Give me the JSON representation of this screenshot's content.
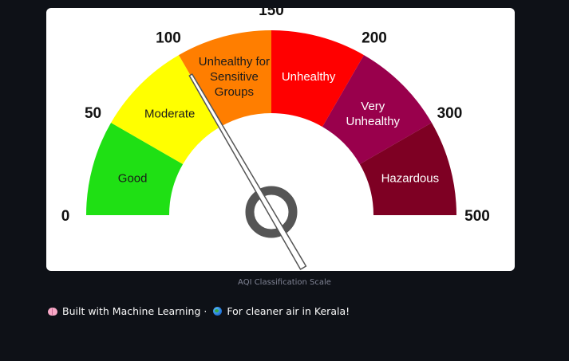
{
  "gauge": {
    "segments": [
      {
        "label": "Good",
        "label_lines": [
          "Good"
        ],
        "color": "#1fe014",
        "text_color": "#1a1a1a"
      },
      {
        "label": "Moderate",
        "label_lines": [
          "Moderate"
        ],
        "color": "#ffff00",
        "text_color": "#1a1a1a"
      },
      {
        "label": "Unhealthy for Sensitive Groups",
        "label_lines": [
          "Unhealthy for",
          "Sensitive",
          "Groups"
        ],
        "color": "#ff7e00",
        "text_color": "#1a1a1a"
      },
      {
        "label": "Unhealthy",
        "label_lines": [
          "Unhealthy"
        ],
        "color": "#ff0000",
        "text_color": "#ffffff"
      },
      {
        "label": "Very Unhealthy",
        "label_lines": [
          "Very",
          "Unhealthy"
        ],
        "color": "#99004c",
        "text_color": "#ffffff"
      },
      {
        "label": "Hazardous",
        "label_lines": [
          "Hazardous"
        ],
        "color": "#7e0023",
        "text_color": "#ffffff"
      }
    ],
    "tick_labels": [
      "0",
      "50",
      "100",
      "150",
      "200",
      "300",
      "500"
    ]
  },
  "caption": "AQI Classification Scale",
  "footer": {
    "brain_icon": "brain-emoji",
    "text1": "Built with Machine Learning",
    "separator": "·",
    "globe_icon": "globe-emoji",
    "text2": "For cleaner air in Kerala!"
  }
}
